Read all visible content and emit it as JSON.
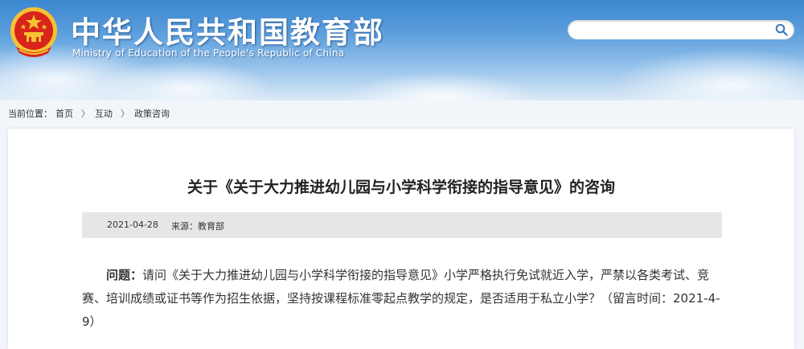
{
  "header": {
    "title_cn": "中华人民共和国教育部",
    "title_en": "Ministry of Education of the People's Republic of China",
    "emblem_icon": "national-emblem-icon",
    "colors": {
      "sky_top": "#3b86cf",
      "sky_bottom": "#dbe9f6",
      "emblem_red": "#d9241c",
      "emblem_gold": "#f6c333"
    }
  },
  "search": {
    "placeholder": "",
    "icon": "search-icon"
  },
  "breadcrumb": {
    "prefix": "当前位置：",
    "items": [
      "首页",
      "互动",
      "政策咨询"
    ],
    "separator": "〉"
  },
  "article": {
    "title": "关于《关于大力推进幼儿园与小学科学衔接的指导意见》的咨询",
    "date": "2021-04-28",
    "source": "来源：教育部",
    "question_label": "问题：",
    "question_text": "请问《关于大力推进幼儿园与小学科学衔接的指导意见》小学严格执行免试就近入学，严禁以各类考试、竞赛、培训成绩或证书等作为招生依据，坚持按课程标准零起点教学的规定，是否适用于私立小学？（留言时间：2021-4-9）"
  }
}
